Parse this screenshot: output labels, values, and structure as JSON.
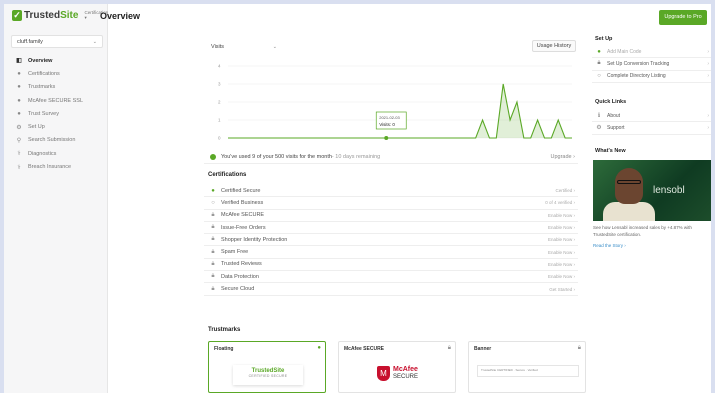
{
  "brand": {
    "name_a": "Trusted",
    "name_b": "Site",
    "product_menu": "Certification"
  },
  "site_select": {
    "value": "cluff.family"
  },
  "nav": [
    {
      "label": "Overview",
      "icon": "dashboard-icon",
      "active": true
    },
    {
      "label": "Certifications",
      "icon": "circle-icon"
    },
    {
      "label": "Trustmarks",
      "icon": "circle-icon"
    },
    {
      "label": "McAfee SECURE SSL",
      "icon": "circle-icon"
    },
    {
      "label": "Trust Survey",
      "icon": "circle-icon"
    },
    {
      "label": "Set Up",
      "icon": "gear-icon"
    },
    {
      "label": "Search Submission",
      "icon": "search-submission-icon"
    },
    {
      "label": "Diagnostics",
      "icon": "diagnostics-icon"
    },
    {
      "label": "Breach Insurance",
      "icon": "insurance-icon"
    }
  ],
  "header": {
    "title": "Overview",
    "upgrade_label": "Upgrade to Pro"
  },
  "chart_controls": {
    "metric": "Visits",
    "usage_history": "Usage History"
  },
  "chart_data": {
    "type": "area",
    "series": [
      {
        "values": [
          0,
          0,
          0,
          0,
          0,
          0,
          0,
          0,
          0,
          0,
          0,
          0,
          0,
          0,
          0,
          0,
          0,
          0,
          0,
          0,
          0,
          0,
          0,
          0,
          0,
          0,
          0,
          0,
          0,
          0,
          0,
          0,
          0,
          0,
          0,
          0,
          0,
          1,
          0,
          0,
          3,
          1,
          2,
          0,
          0,
          1,
          0,
          0,
          1,
          0,
          0
        ]
      }
    ],
    "yticks": [
      "4",
      "3",
      "2",
      "1",
      "0"
    ],
    "ylim": [
      0,
      4
    ],
    "color": "#5aa826",
    "tooltip": {
      "date": "2021-02-03",
      "text": "Visits: 0"
    }
  },
  "usage": {
    "text": "You've used 9 of your 500 visits for the month",
    "remaining": " - 10 days remaining",
    "action": "Upgrade"
  },
  "certifications": {
    "title": "Certifications",
    "items": [
      {
        "label": "Certified Secure",
        "action": "Certified",
        "status": "ok"
      },
      {
        "label": "Verified Business",
        "action": "0 of 4 verified",
        "status": "open"
      },
      {
        "label": "McAfee SECURE",
        "action": "Enable Now",
        "status": "lock"
      },
      {
        "label": "Issue-Free Orders",
        "action": "Enable Now",
        "status": "lock"
      },
      {
        "label": "Shopper Identity Protection",
        "action": "Enable Now",
        "status": "lock"
      },
      {
        "label": "Spam Free",
        "action": "Enable Now",
        "status": "lock"
      },
      {
        "label": "Trusted Reviews",
        "action": "Enable Now",
        "status": "lock"
      },
      {
        "label": "Data Protection",
        "action": "Enable Now",
        "status": "lock"
      },
      {
        "label": "Secure Cloud",
        "action": "Get Started",
        "status": "lock"
      }
    ]
  },
  "trustmarks": {
    "title": "Trustmarks",
    "cards": [
      {
        "name": "Floating",
        "badge_a": "TrustedSite",
        "badge_b": "CERTIFIED SECURE"
      },
      {
        "name": "McAfee SECURE",
        "badge_a": "McAfee",
        "badge_b": "SECURE"
      },
      {
        "name": "Banner",
        "strip": "TrustedSite  CERTIFIED  ·  Secure  ·  Verified"
      }
    ]
  },
  "setup": {
    "title": "Set Up",
    "items": [
      {
        "label": "Add Main Code",
        "done": true
      },
      {
        "label": "Set Up Conversion Tracking",
        "done": false,
        "lock": true
      },
      {
        "label": "Complete Directory Listing",
        "done": false
      }
    ]
  },
  "quick_links": {
    "title": "Quick Links",
    "items": [
      {
        "label": "About",
        "icon": "info-icon"
      },
      {
        "label": "Support",
        "icon": "gear-icon"
      }
    ]
  },
  "whats_new": {
    "title": "What's New",
    "brand": "lensobl",
    "text": "See how Lensabl increased sales by +4.87% with TrustedSite certification.",
    "link": "Read the Story ›"
  }
}
